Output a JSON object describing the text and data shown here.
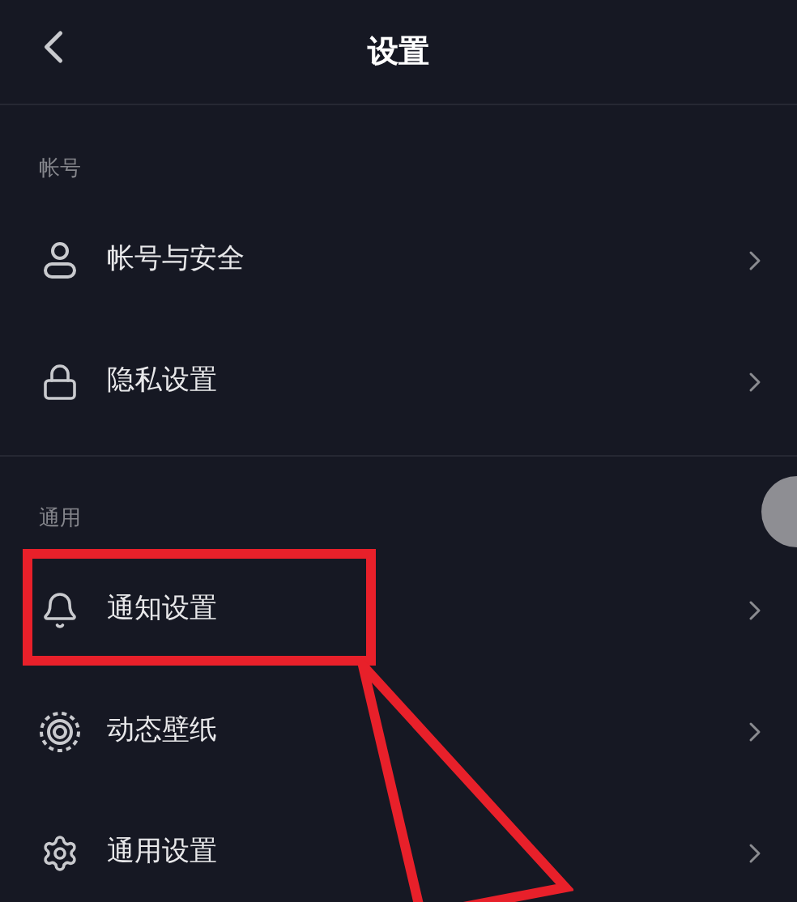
{
  "header": {
    "back_icon": true,
    "title": "设置"
  },
  "sections": [
    {
      "label": "帐号",
      "items": [
        {
          "kind": "account",
          "label": "帐号与安全",
          "highlighted": false
        },
        {
          "kind": "privacy",
          "label": "隐私设置",
          "highlighted": false
        }
      ]
    },
    {
      "label": "通用",
      "items": [
        {
          "kind": "notification",
          "label": "通知设置",
          "highlighted": true
        },
        {
          "kind": "wallpaper",
          "label": "动态壁纸",
          "highlighted": false
        },
        {
          "kind": "general",
          "label": "通用设置",
          "highlighted": false
        }
      ]
    }
  ]
}
